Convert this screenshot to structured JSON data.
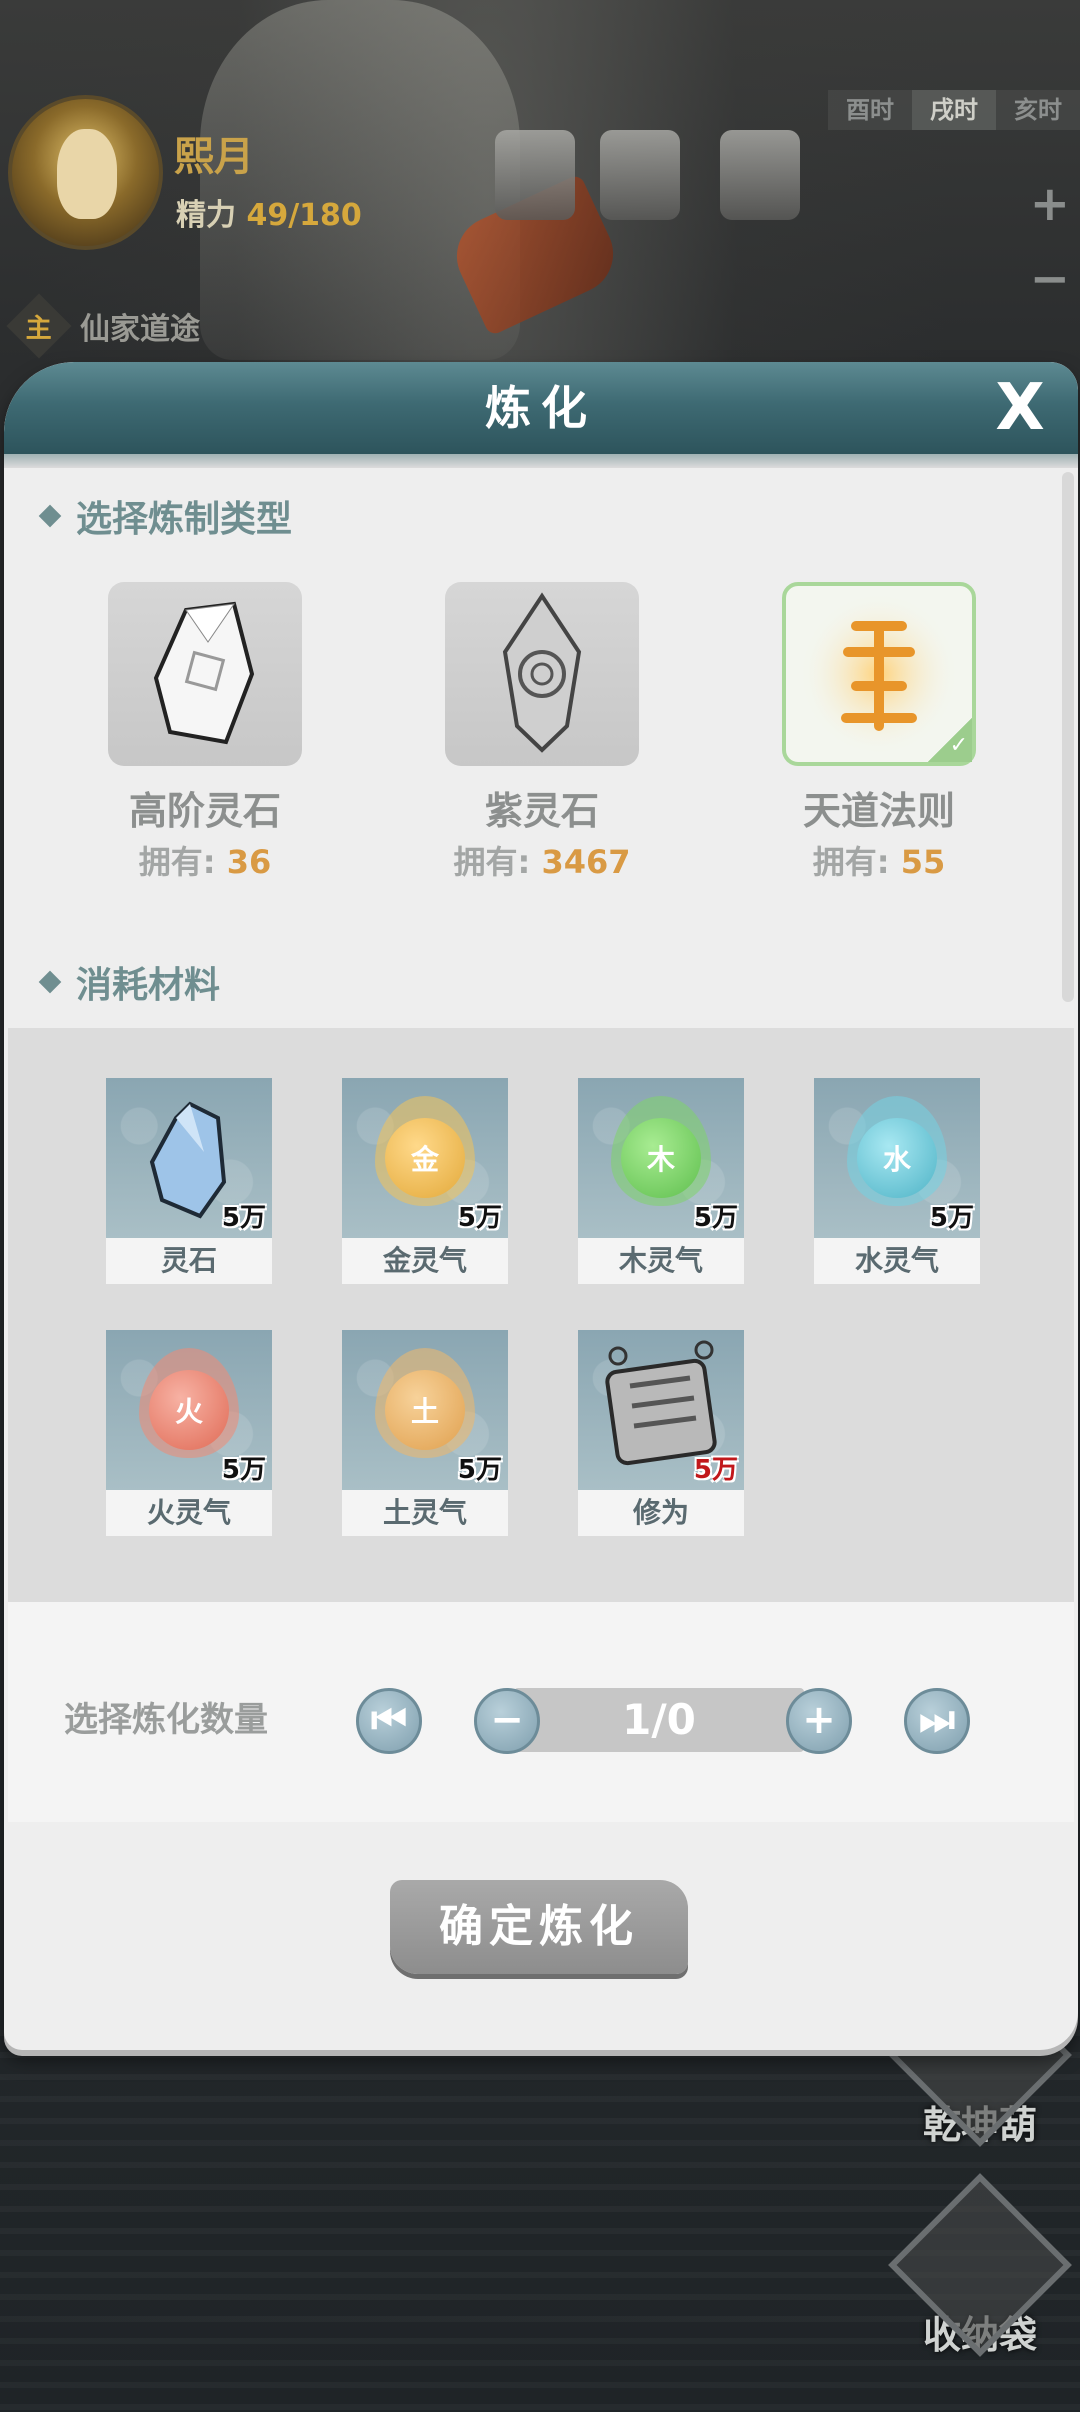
{
  "hud": {
    "player_name": "熙月",
    "energy_label": "精力",
    "energy_value": "49/180",
    "quest_badge": "主",
    "quest_text": "仙家道途",
    "time_tabs": [
      "酉时",
      "戌时",
      "亥时"
    ],
    "active_time_tab": 1
  },
  "side_buttons": {
    "gourd_label": "乾坤葫",
    "bag_label": "收纳袋"
  },
  "dialog": {
    "title": "炼化",
    "close_label": "X",
    "section_type_title": "选择炼制类型",
    "section_materials_title": "消耗材料",
    "types": [
      {
        "name": "高阶灵石",
        "owned_label": "拥有:",
        "owned": "36",
        "selected": false
      },
      {
        "name": "紫灵石",
        "owned_label": "拥有:",
        "owned": "3467",
        "selected": false
      },
      {
        "name": "天道法则",
        "owned_label": "拥有:",
        "owned": "55",
        "selected": true
      }
    ],
    "materials": [
      {
        "name": "灵石",
        "count": "5万",
        "icon": "crystal-icon",
        "insufficient": false
      },
      {
        "name": "金灵气",
        "count": "5万",
        "icon": "metal-orb-icon",
        "glyph": "金",
        "color": "#e3a93a",
        "insufficient": false
      },
      {
        "name": "木灵气",
        "count": "5万",
        "icon": "wood-orb-icon",
        "glyph": "木",
        "color": "#5fbf4e",
        "insufficient": false
      },
      {
        "name": "水灵气",
        "count": "5万",
        "icon": "water-orb-icon",
        "glyph": "水",
        "color": "#4eb3c6",
        "insufficient": false
      },
      {
        "name": "火灵气",
        "count": "5万",
        "icon": "fire-orb-icon",
        "glyph": "火",
        "color": "#e06a55",
        "insufficient": false
      },
      {
        "name": "土灵气",
        "count": "5万",
        "icon": "earth-orb-icon",
        "glyph": "土",
        "color": "#e0a04e",
        "insufficient": false
      },
      {
        "name": "修为",
        "count": "5万",
        "icon": "scroll-icon",
        "insufficient": true
      }
    ],
    "quantity_label": "选择炼化数量",
    "quantity_value": "1/0",
    "confirm_label": "确定炼化"
  },
  "colors": {
    "header_teal": "#3e6a73",
    "accent_orange": "#d99a44",
    "section_title": "#6f8e90",
    "insufficient_red": "#c1181b"
  }
}
